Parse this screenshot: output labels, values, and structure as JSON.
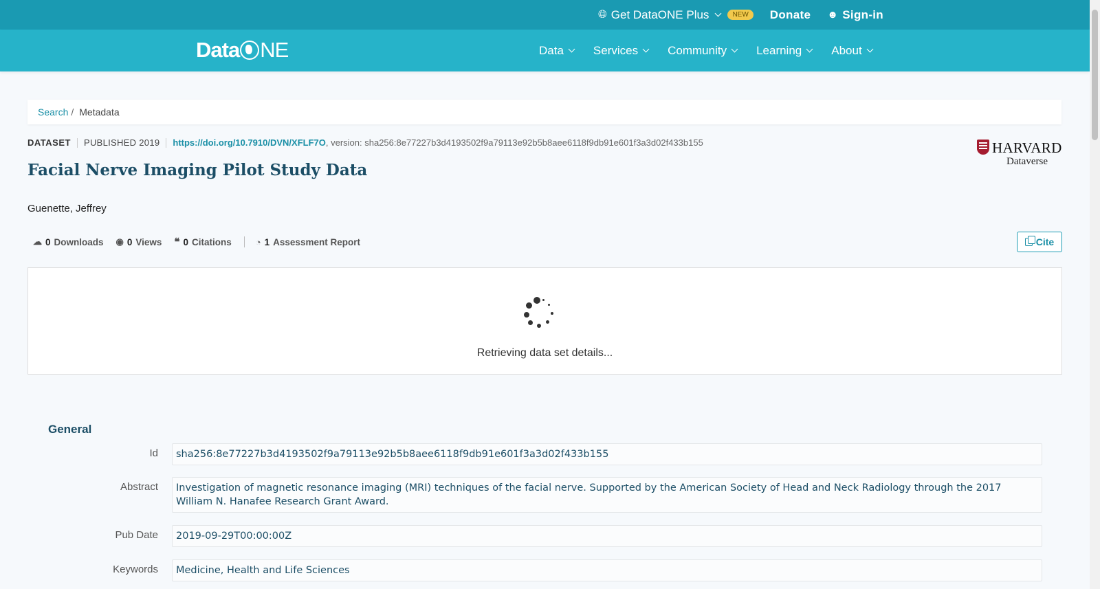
{
  "topbar": {
    "plus_label": "Get DataONE Plus",
    "plus_badge": "NEW",
    "donate_label": "Donate",
    "signin_label": "Sign-in"
  },
  "navbar": {
    "logo_prefix": "Data",
    "logo_suffix": "NE",
    "items": [
      {
        "label": "Data"
      },
      {
        "label": "Services"
      },
      {
        "label": "Community"
      },
      {
        "label": "Learning"
      },
      {
        "label": "About"
      }
    ]
  },
  "breadcrumb": {
    "search_label": "Search",
    "separator": "/",
    "current_label": "Metadata"
  },
  "dataset": {
    "type_label": "DATASET",
    "published_label": "PUBLISHED 2019",
    "doi": "https://doi.org/10.7910/DVN/XFLF7O",
    "version_text": ", version: sha256:8e77227b3d4193502f9a79113e92b5b8aee6118f9db91e601f3a3d02f433b155",
    "title": "Facial Nerve Imaging Pilot Study Data",
    "author": "Guenette, Jeffrey",
    "repository_name": "HARVARD",
    "repository_sub": "Dataverse"
  },
  "metrics": {
    "downloads_count": "0",
    "downloads_label": "Downloads",
    "views_count": "0",
    "views_label": "Views",
    "citations_count": "0",
    "citations_label": "Citations",
    "assessment_count": "1",
    "assessment_label": "Assessment Report"
  },
  "cite_label": "Cite",
  "loading_text": "Retrieving data set details...",
  "general": {
    "section_title": "General",
    "fields": [
      {
        "label": "Id",
        "value": "sha256:8e77227b3d4193502f9a79113e92b5b8aee6118f9db91e601f3a3d02f433b155"
      },
      {
        "label": "Abstract",
        "value": "Investigation of magnetic resonance imaging (MRI) techniques of the facial nerve. Supported by the American Society of Head and Neck Radiology through the 2017 William N. Hanafee Research Grant Award."
      },
      {
        "label": "Pub Date",
        "value": "2019-09-29T00:00:00Z"
      },
      {
        "label": "Keywords",
        "value": "Medicine, Health and Life Sciences"
      }
    ]
  },
  "colors": {
    "topbar_bg": "#1a9ab2",
    "navbar_bg": "#26b3c9",
    "accent": "#1a8fa6",
    "title_color": "#1c4e66",
    "harvard_crimson": "#a51c30",
    "badge_bg": "#f2c94c"
  },
  "icons": {
    "plus": "globe-plus-icon",
    "signin": "user-icon",
    "downloads": "cloud-download-icon",
    "views": "eye-icon",
    "citations": "quote-icon",
    "assessment": "gauge-icon",
    "cite": "copy-icon",
    "loading": "spinner-icon"
  }
}
